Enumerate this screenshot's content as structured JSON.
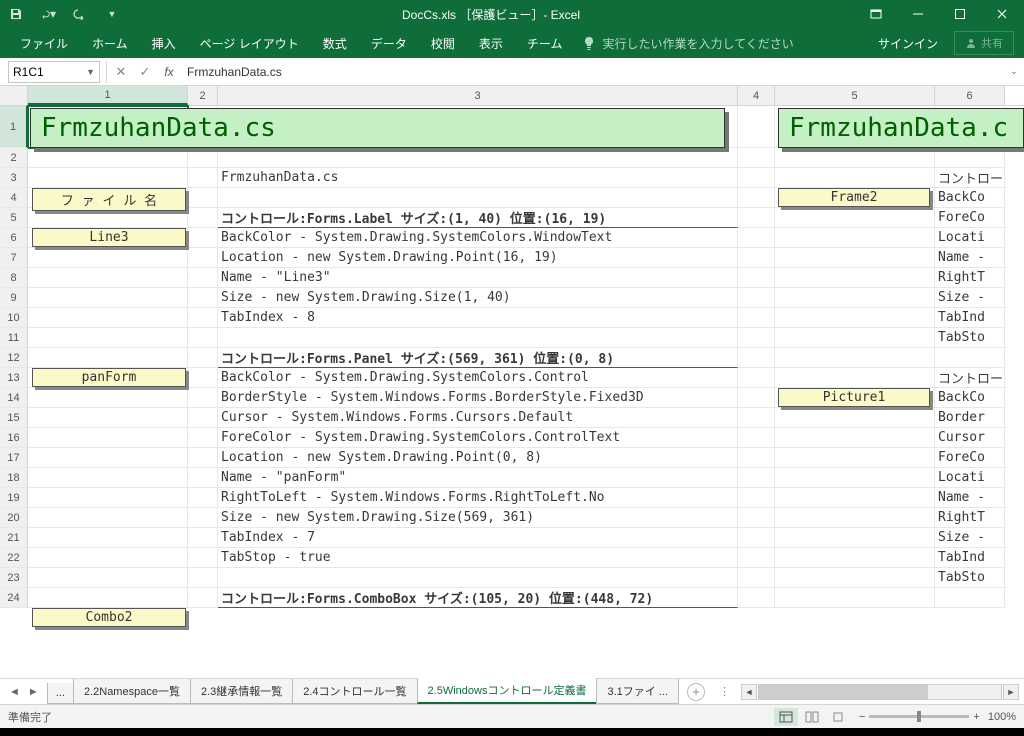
{
  "window": {
    "title": "DocCs.xls ［保護ビュー］- Excel"
  },
  "quickaccess": {
    "save": "save",
    "undo": "undo",
    "redo": "redo"
  },
  "ribbon": {
    "tabs": [
      "ファイル",
      "ホーム",
      "挿入",
      "ページ レイアウト",
      "数式",
      "データ",
      "校閲",
      "表示",
      "チーム"
    ],
    "tell_placeholder": "実行したい作業を入力してください",
    "signin": "サインイン",
    "share": "共有"
  },
  "namebox": "R1C1",
  "formula": "FrmzuhanData.cs",
  "columns": [
    "1",
    "2",
    "3",
    "4",
    "5",
    "6"
  ],
  "rows_count": 24,
  "banners": {
    "left": "FrmzuhanData.cs",
    "right": "FrmzuhanData.c"
  },
  "labels": {
    "filename": "フ ァ イ ル 名",
    "line3": "Line3",
    "panform": "panForm",
    "combo2": "Combo2",
    "frame2": "Frame2",
    "picture1": "Picture1"
  },
  "cells": {
    "r3c3": "FrmzuhanData.cs",
    "r5c3": "コントロール:Forms.Label サイズ:(1, 40) 位置:(16, 19)",
    "r6c3": "BackColor - System.Drawing.SystemColors.WindowText",
    "r7c3": "Location - new System.Drawing.Point(16, 19)",
    "r8c3": "Name - \"Line3\"",
    "r9c3": "Size - new System.Drawing.Size(1, 40)",
    "r10c3": "TabIndex - 8",
    "r12c3": "コントロール:Forms.Panel サイズ:(569, 361) 位置:(0, 8)",
    "r13c3": "BackColor - System.Drawing.SystemColors.Control",
    "r14c3": "BorderStyle - System.Windows.Forms.BorderStyle.Fixed3D",
    "r15c3": "Cursor - System.Windows.Forms.Cursors.Default",
    "r16c3": "ForeColor - System.Drawing.SystemColors.ControlText",
    "r17c3": "Location - new System.Drawing.Point(0, 8)",
    "r18c3": "Name - \"panForm\"",
    "r19c3": "RightToLeft - System.Windows.Forms.RightToLeft.No",
    "r20c3": "Size - new System.Drawing.Size(569, 361)",
    "r21c3": "TabIndex - 7",
    "r22c3": "TabStop - true",
    "r24c3": "コントロール:Forms.ComboBox サイズ:(105, 20) 位置:(448, 72)",
    "r3f": "コントロー",
    "r4f": "BackCo",
    "r5f": "ForeCo",
    "r6f": "Locati",
    "r7f": "Name -",
    "r8f": "RightT",
    "r9f": "Size -",
    "r10f": "TabInd",
    "r11f": "TabSto",
    "r13f": "コントロー",
    "r14f": "BackCo",
    "r15f": "Border",
    "r16f": "Cursor",
    "r17f": "ForeCo",
    "r18f": "Locati",
    "r19f": "Name -",
    "r20f": "RightT",
    "r21f": "Size -",
    "r22f": "TabInd",
    "r23f": "TabSto"
  },
  "sheets": {
    "ellipsis": "...",
    "items": [
      "2.2Namespace一覧",
      "2.3継承情報一覧",
      "2.4コントロール一覧",
      "2.5Windowsコントロール定義書",
      "3.1ファイ ..."
    ],
    "active_index": 3
  },
  "status": {
    "ready": "準備完了",
    "zoom": "100%"
  }
}
